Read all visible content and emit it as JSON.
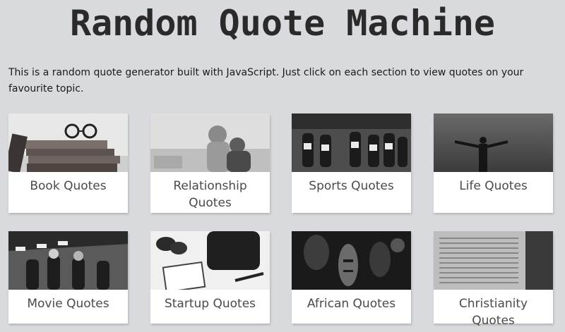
{
  "header": {
    "title": "Random Quote Machine"
  },
  "intro": {
    "text": "This is a random quote generator built with JavaScript. Just click on each section to view quotes on your favourite topic."
  },
  "cards": [
    {
      "label": "Book Quotes",
      "icon": "book-stack-image"
    },
    {
      "label": "Relationship Quotes",
      "icon": "couple-image"
    },
    {
      "label": "Sports Quotes",
      "icon": "runners-image"
    },
    {
      "label": "Life Quotes",
      "icon": "person-arms-open-image"
    },
    {
      "label": "Movie Quotes",
      "icon": "film-set-image"
    },
    {
      "label": "Startup Quotes",
      "icon": "desk-items-image"
    },
    {
      "label": "African Quotes",
      "icon": "african-mask-image"
    },
    {
      "label": "Christianity Quotes",
      "icon": "bible-page-image"
    }
  ],
  "colors": {
    "background": "#d9dadd",
    "card": "#ffffff",
    "label": "#4a4a4a"
  }
}
